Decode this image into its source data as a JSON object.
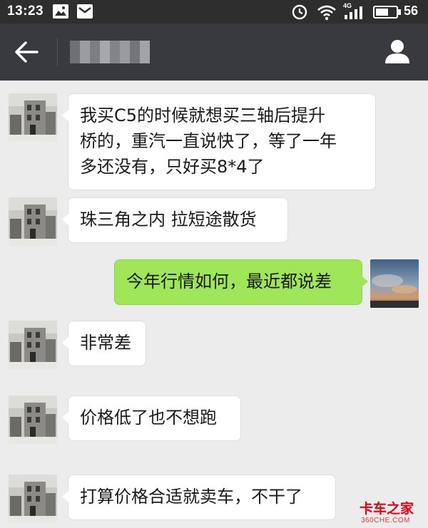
{
  "status_bar": {
    "time": "13:23",
    "battery_level": "56",
    "network_type": "4G",
    "icons": [
      "image-notification-icon",
      "mail-notification-icon",
      "alarm-icon",
      "wifi-icon",
      "signal-icon",
      "battery-icon"
    ]
  },
  "title_bar": {
    "contact_name": "",
    "back_icon": "arrow-left-icon",
    "profile_icon": "person-icon"
  },
  "messages": [
    {
      "direction": "in",
      "text_lines": [
        "我买C5的时候就想买三轴后提升",
        "桥的，重汽一直说快了，等了一年",
        "多还没有，只好买8*4了"
      ]
    },
    {
      "direction": "in",
      "text_lines": [
        "珠三角之内 拉短途散货"
      ]
    },
    {
      "direction": "out",
      "text_lines": [
        "今年行情如何，最近都说差"
      ]
    },
    {
      "direction": "in",
      "text_lines": [
        "非常差"
      ]
    },
    {
      "direction": "in",
      "text_lines": [
        "价格低了也不想跑"
      ]
    },
    {
      "direction": "in",
      "text_lines": [
        "打算价格合适就卖车，不干了"
      ]
    }
  ],
  "watermark": {
    "logo_text": "卡车之家",
    "site_text": "360CHE.COM"
  },
  "colors": {
    "status_bar_bg": "#2e2e2e",
    "title_bar_bg": "#393a3f",
    "chat_bg": "#ececec",
    "incoming_bubble": "#ffffff",
    "outgoing_bubble": "#9fe658",
    "watermark_red": "#e60012"
  }
}
